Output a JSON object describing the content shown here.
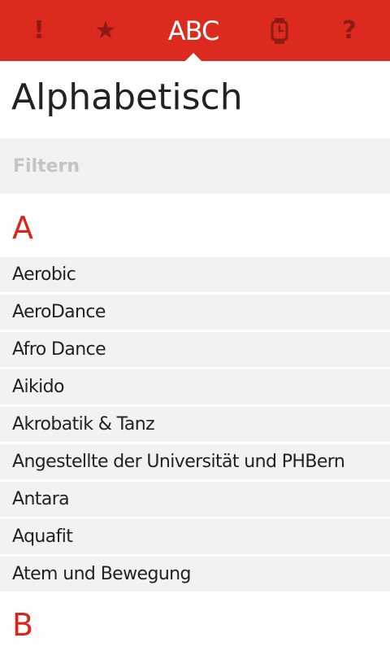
{
  "tabs": [
    {
      "label": "!",
      "icon": "alert-icon"
    },
    {
      "label": "★",
      "icon": "star-icon"
    },
    {
      "label": "ABC",
      "icon": "abc-icon",
      "active": true
    },
    {
      "label": "",
      "icon": "watch-icon"
    },
    {
      "label": "?",
      "icon": "help-icon"
    }
  ],
  "colors": {
    "accent": "#dc2a1f",
    "inactive_icon": "#8e1a13",
    "list_bg": "#f2f2f2"
  },
  "page": {
    "title": "Alphabetisch"
  },
  "filter": {
    "placeholder": "Filtern"
  },
  "sections": [
    {
      "letter": "A",
      "items": [
        "Aerobic",
        "AeroDance",
        "Afro Dance",
        "Aikido",
        "Akrobatik & Tanz",
        "Angestellte der Universität und PHBern",
        "Antara",
        "Aquafit",
        "Atem und Bewegung"
      ]
    },
    {
      "letter": "B",
      "items": []
    }
  ]
}
